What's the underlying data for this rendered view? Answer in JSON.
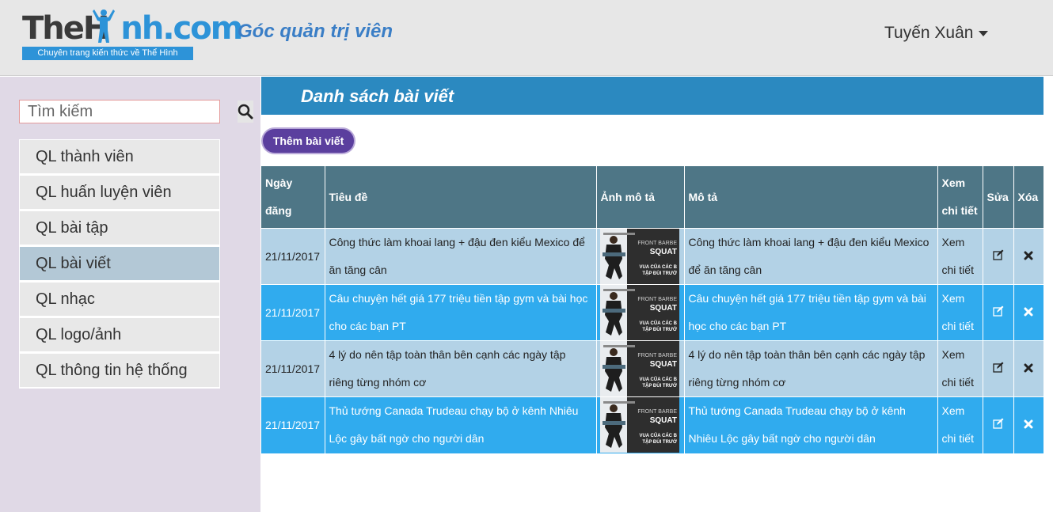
{
  "header": {
    "logo_text_1": "TheH",
    "logo_text_2": "nh.com",
    "logo_tagline": "Chuyên trang kiến thức về Thể Hình",
    "admin_title": "Góc quản trị viên",
    "user_name": "Tuyến Xuân"
  },
  "sidebar": {
    "search_placeholder": "Tìm kiếm",
    "items": [
      {
        "label": "QL thành viên"
      },
      {
        "label": "QL huấn luyện viên"
      },
      {
        "label": "QL bài tập"
      },
      {
        "label": "QL bài viết"
      },
      {
        "label": "QL nhạc"
      },
      {
        "label": "QL logo/ảnh"
      },
      {
        "label": "QL thông tin hệ thống"
      }
    ],
    "active_item": "QL bài viết"
  },
  "main": {
    "title": "Danh sách bài viết",
    "add_button": "Thêm bài viết",
    "table": {
      "headers": {
        "date": "Ngày đăng",
        "title": "Tiêu đề",
        "image": "Ảnh mô tả",
        "description": "Mô tả",
        "details": "Xem chi tiết",
        "edit": "Sửa",
        "delete": "Xóa"
      },
      "rows": [
        {
          "date": "21/11/2017",
          "title": "Công thức làm khoai lang + đậu đen kiểu Mexico để ăn tăng cân",
          "description": "Công thức làm khoai lang + đậu đen kiểu Mexico để ăn tăng cân",
          "details": "Xem chi tiết"
        },
        {
          "date": "21/11/2017",
          "title": "Câu chuyện hết giá 177 triệu tiền tập gym và bài học cho các bạn PT",
          "description": "Câu chuyện hết giá 177 triệu tiền tập gym và bài học cho các bạn PT",
          "details": "Xem chi tiết"
        },
        {
          "date": "21/11/2017",
          "title": "4 lý do nên tập toàn thân bên cạnh các ngày tập riêng từng nhóm cơ",
          "description": "4 lý do nên tập toàn thân bên cạnh các ngày tập riêng từng nhóm cơ",
          "details": "Xem chi tiết"
        },
        {
          "date": "21/11/2017",
          "title": "Thủ tướng Canada Trudeau chạy bộ ở kênh Nhiêu Lộc gây bất ngờ cho người dân",
          "description": "Thủ tướng Canada Trudeau chạy bộ ở kênh Nhiêu Lộc gây bất ngờ cho người dân",
          "details": "Xem chi tiết"
        }
      ],
      "thumbnail_text": {
        "line1": "FRONT BARBE",
        "line2": "SQUAT",
        "line3": "VUA CỦA CÁC B",
        "line4": "TẬP ĐÙI TRƯỚ"
      }
    }
  }
}
